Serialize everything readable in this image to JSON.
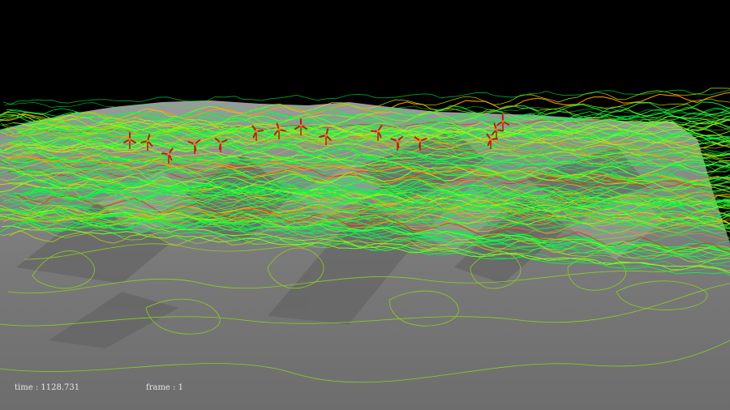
{
  "hud": {
    "time_label": "time",
    "time_value": "1128.731",
    "frame_label": "frame",
    "frame_value": "1"
  },
  "scene": {
    "background_color": "#000000",
    "terrain_color": "#7c7c7c",
    "terrain_dark_color": "#5a5a5a",
    "streamline_colors": [
      "#00ff44",
      "#7dff1a",
      "#c8e600",
      "#ff9a00",
      "#e03000"
    ],
    "contour_color": "#8fd81a",
    "turbine_color": "#c01a00",
    "turbine_count": 15,
    "turbine_icon": "wind-turbine-icon"
  }
}
